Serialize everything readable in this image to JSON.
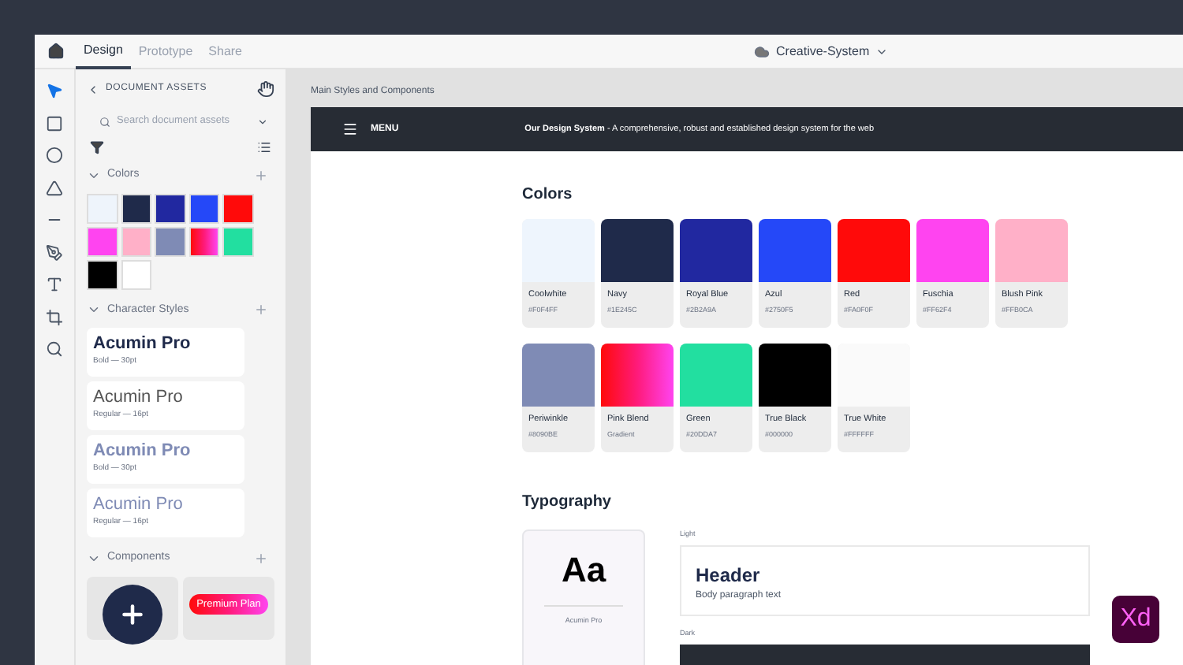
{
  "top_bar": {
    "tabs": [
      {
        "label": "Design",
        "selected": true
      },
      {
        "label": "Prototype",
        "selected": false
      },
      {
        "label": "Share",
        "selected": false
      }
    ],
    "document_title": "Creative-System"
  },
  "tools": [
    {
      "kind": "select",
      "selected": true
    },
    {
      "kind": "rectangle",
      "selected": false
    },
    {
      "kind": "ellipse",
      "selected": false
    },
    {
      "kind": "triangle",
      "selected": false
    },
    {
      "kind": "line",
      "selected": false
    },
    {
      "kind": "pen",
      "selected": false
    },
    {
      "kind": "text",
      "selected": false
    },
    {
      "kind": "crop",
      "selected": false
    },
    {
      "kind": "zoom",
      "selected": false
    }
  ],
  "assets": {
    "title": "DOCUMENT ASSETS",
    "search_placeholder": "Search document assets",
    "colors": {
      "title": "Colors",
      "expanded": true,
      "swatches": [
        {
          "color": "#eef4fb"
        },
        {
          "color": "#1f2a4a"
        },
        {
          "color": "#2128a0"
        },
        {
          "color": "#2548f8"
        },
        {
          "color": "#ff0a0a"
        },
        {
          "color": "#ff44f0"
        },
        {
          "color": "#ffb0c8"
        },
        {
          "color": "#7f8bb5"
        },
        {
          "kind": "gradient"
        },
        {
          "color": "#22dfa0"
        },
        {
          "color": "#000000"
        },
        {
          "color": "#ffffff"
        }
      ]
    },
    "character_styles": {
      "title": "Character Styles",
      "expanded": true,
      "items": [
        {
          "name": "Acumin Pro",
          "detail": "Bold — 30pt",
          "kind": "bold",
          "color": "#1f2a4a"
        },
        {
          "name": "Acumin Pro",
          "detail": "Regular — 16pt",
          "kind": "regular",
          "color": "#555555"
        },
        {
          "name": "Acumin Pro",
          "detail": "Bold — 30pt",
          "kind": "bold",
          "color": "#7f8bb5"
        },
        {
          "name": "Acumin Pro",
          "detail": "Regular — 16pt",
          "kind": "regular",
          "color": "#7f8bb5"
        }
      ]
    },
    "components": {
      "title": "Components",
      "expanded": true,
      "items": [
        {
          "kind": "plus_button"
        },
        {
          "kind": "pill",
          "label": "Premium Plan"
        }
      ]
    }
  },
  "canvas": {
    "artboard_title": "Main Styles and Components",
    "header": {
      "menu": "MENU",
      "tagline": "**Our Design System** - A comprehensive, robust and established design system for the web"
    },
    "colors_title": "Colors",
    "color_rows": [
      [
        {
          "name": "Coolwhite",
          "code": "#F0F4FF",
          "color": "#eef5fd"
        },
        {
          "name": "Navy",
          "code": "#1E245C",
          "color": "#1f2a4a"
        },
        {
          "name": "Royal Blue",
          "code": "#2B2A9A",
          "color": "#2128a0"
        },
        {
          "name": "Azul",
          "code": "#2750F5",
          "color": "#2548f8"
        },
        {
          "name": "Red",
          "code": "#FA0F0F",
          "color": "#ff0a0a"
        },
        {
          "name": "Fuschia",
          "code": "#FF62F4",
          "color": "#ff44f0"
        },
        {
          "name": "Blush Pink",
          "code": "#FFB0CA",
          "color": "#ffb0c8"
        }
      ],
      [
        {
          "name": "Periwinkle",
          "code": "#8090BE",
          "color": "#7f8bb5"
        },
        {
          "name": "Pink Blend",
          "code": "Gradient",
          "kind": "gradient"
        },
        {
          "name": "Green",
          "code": "#20DDA7",
          "color": "#22dfa0"
        },
        {
          "name": "True Black",
          "code": "#000000",
          "color": "#000000"
        },
        {
          "name": "True White",
          "code": "#FFFFFF",
          "color": "#fafafa"
        }
      ]
    ],
    "typography_title": "Typography",
    "font_card": {
      "sample": "Aa",
      "name": "Acumin Pro"
    },
    "light": {
      "label": "Light",
      "header": "Header",
      "body": "Body paragraph text"
    },
    "dark": {
      "label": "Dark"
    }
  },
  "app_badge": "Xd"
}
